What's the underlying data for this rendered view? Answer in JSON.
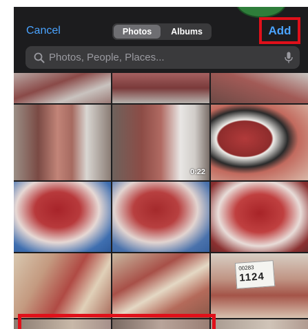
{
  "header": {
    "cancel_label": "Cancel",
    "tabs": [
      {
        "label": "Photos",
        "active": true
      },
      {
        "label": "Albums",
        "active": false
      }
    ],
    "add_label": "Add"
  },
  "search": {
    "placeholder": "Photos, People, Places...",
    "icon": "magnifying-glass",
    "mic_icon": "microphone"
  },
  "grid": {
    "video_duration": "0:22",
    "tag_line1": "00283",
    "tag_line2": "1124"
  },
  "colors": {
    "accent": "#4aa3ff",
    "highlight": "#e0101a",
    "background": "#1c1c1e"
  }
}
